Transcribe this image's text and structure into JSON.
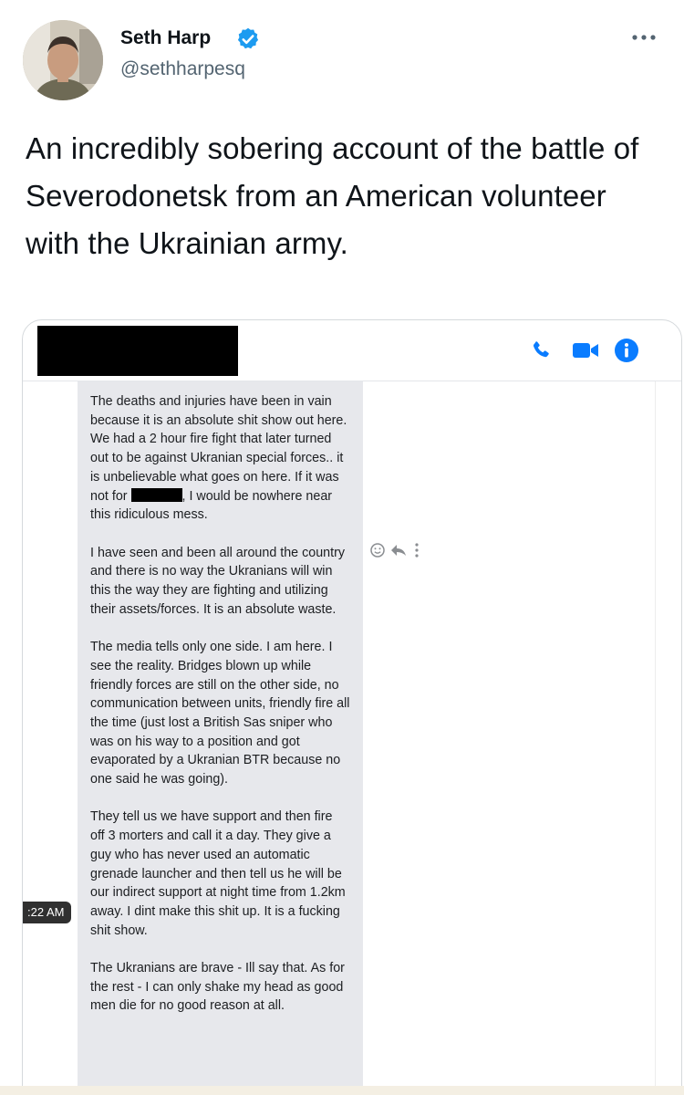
{
  "tweet": {
    "author_name": "Seth Harp",
    "author_handle": "@sethharpesq",
    "verified_icon": "verified-badge-icon",
    "more_icon": "more-options-icon",
    "text": "An incredibly sobering account of the battle of Severodonetsk from an American volunteer with the Ukrainian army.",
    "colors": {
      "verified": "#1d9bf0",
      "text": "#0f1419",
      "secondary": "#536471"
    }
  },
  "media": {
    "header": {
      "icons": [
        "phone-icon",
        "video-camera-icon",
        "info-icon"
      ],
      "accent_color": "#0a7cff"
    },
    "message": {
      "p1_a": "The deaths and injuries have been in vain because it is an absolute shit show out here. We had a 2 hour fire fight that later turned out to be against Ukranian special forces.. it is unbelievable what goes on here. If it was not for",
      "p1_b": ", I would be nowhere near this ridiculous mess.",
      "p2": "I have seen and been all around the country and there is no way the Ukranians will win this the way they are fighting and utilizing their assets/forces. It is an absolute waste.",
      "p3": "The media tells only one side. I am here. I see the reality. Bridges blown up while friendly forces are still on the other side, no communication between units, friendly fire all the time (just lost a British Sas sniper who was on his way to a position and got evaporated by a Ukranian BTR because no one said he was going).",
      "p4": "They tell us we have support and then fire off 3 morters and call it a day. They give a guy who has never used an automatic grenade launcher and then tell us he will be our indirect support at night time from 1.2km away. I dint make this shit up. It is a fucking shit show.",
      "p5": "The Ukranians are brave - Ill say that. As for the rest - I can only shake my head as good men die for no good reason at all."
    },
    "timestamp": ":22 AM",
    "action_icons": [
      "emoji-reaction-icon",
      "reply-icon",
      "more-vertical-icon"
    ]
  }
}
